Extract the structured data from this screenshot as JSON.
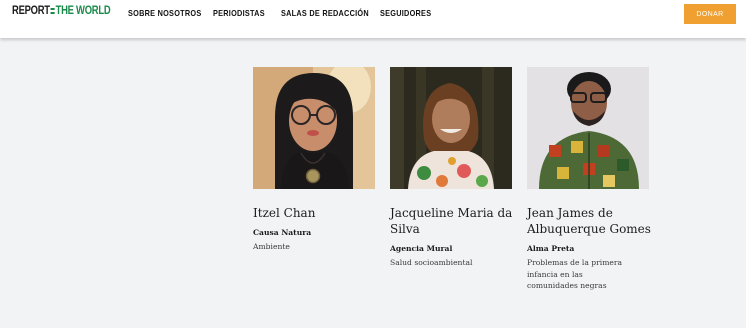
{
  "header": {
    "logo": {
      "word1": "REPORT",
      "word2": "THE WORLD",
      "brand_color": "#1a8a4a"
    },
    "nav": [
      "SOBRE NOSOTROS",
      "PERIODISTAS",
      "SALAS DE REDACCIÓN",
      "SEGUIDORES"
    ],
    "donate_label": "DONAR",
    "donate_color": "#f0a030"
  },
  "journalists": [
    {
      "name": "Itzel Chan",
      "outlet": "Causa Natura",
      "topic": "Ambiente"
    },
    {
      "name": "Jacqueline Maria da Silva",
      "outlet": "Agencia Mural",
      "topic": "Salud socioambiental"
    },
    {
      "name": "Jean James de Albuquerque Gomes",
      "outlet": "Alma Preta",
      "topic": "Problemas de la primera infancia en las comunidades negras"
    }
  ]
}
